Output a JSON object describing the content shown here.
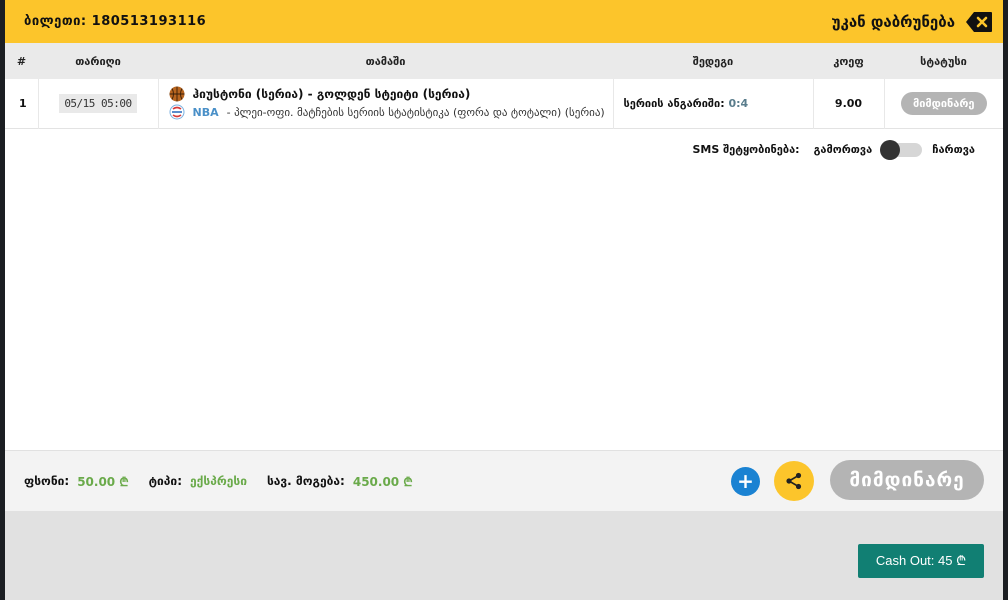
{
  "header": {
    "ticket_label": "ბილეთი:",
    "ticket_number": "180513193116",
    "back_label": "უკან დაბრუნება"
  },
  "table": {
    "columns": [
      "#",
      "თარიღი",
      "თამაში",
      "შედეგი",
      "კოეფ",
      "სტატუსი"
    ],
    "rows": [
      {
        "num": "1",
        "date": "05/15 05:00",
        "match": "ჰიუსტონი (სერია) - გოლდენ სტეიტი (სერია)",
        "league": "NBA",
        "market": "- პლეი-ოფი. მატჩების სერიის სტატისტიკა (ფორა და ტოტალი) (სერია)",
        "result_label": "სერიის ანგარიში:",
        "score": "0:4",
        "odds": "9.00",
        "status": "მიმდინარე"
      }
    ]
  },
  "sms": {
    "label": "SMS შეტყობინება:",
    "off_label": "გამორთვა",
    "on_label": "ჩართვა"
  },
  "footer": {
    "stake_label": "ფსონი:",
    "stake_value": "50.00",
    "type_label": "ტიპი:",
    "type_value": "ექსპრესი",
    "win_label": "სავ. მოგება:",
    "win_value": "450.00",
    "currency": "₾",
    "plus": "+",
    "status_big": "მიმდინარე"
  },
  "cashout": {
    "label": "Cash Out: 45 ₾"
  },
  "colors": {
    "accent": "#fcc52b",
    "cashout": "#117f73",
    "green": "#6aaa4a",
    "plus": "#1a82d2"
  }
}
